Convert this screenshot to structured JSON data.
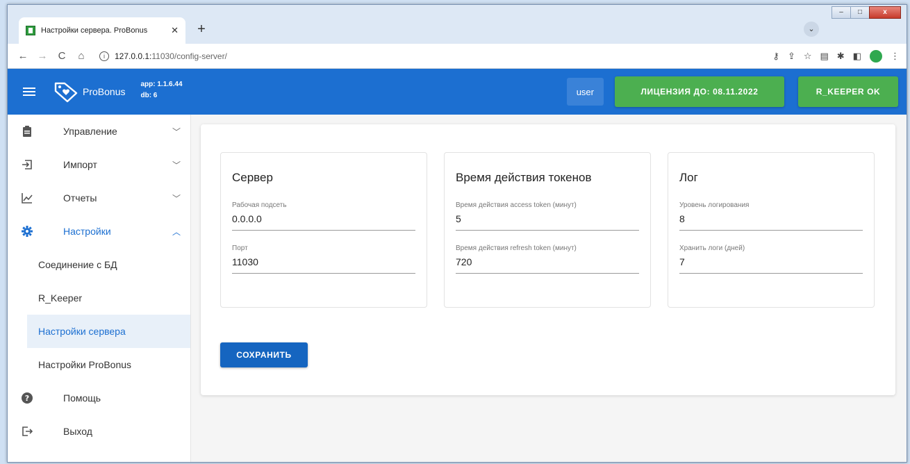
{
  "browser": {
    "tab_title": "Настройки сервера. ProBonus",
    "tab_close": "✕",
    "new_tab": "+",
    "url_host": "127.0.0.1:",
    "url_rest": "11030/config-server/"
  },
  "header": {
    "app_name": "ProBonus",
    "app_version": "app: 1.1.6.44",
    "db_version": "db: 6",
    "user_label": "user",
    "license_label": "ЛИЦЕНЗИЯ ДО: 08.11.2022",
    "rkeeper_label": "R_KEEPER OK",
    "accent_color": "#1c6fd1",
    "ok_color": "#4caf50"
  },
  "sidebar": {
    "items": [
      {
        "label": "Управление",
        "icon": "clipboard-icon",
        "expanded": false
      },
      {
        "label": "Импорт",
        "icon": "import-icon",
        "expanded": false
      },
      {
        "label": "Отчеты",
        "icon": "chart-icon",
        "expanded": false
      },
      {
        "label": "Настройки",
        "icon": "gear-icon",
        "expanded": true
      }
    ],
    "sub_items": [
      {
        "label": "Соединение с БД"
      },
      {
        "label": "R_Keeper"
      },
      {
        "label": "Настройки сервера",
        "active": true
      },
      {
        "label": "Настройки ProBonus"
      }
    ],
    "bottom_items": [
      {
        "label": "Помощь",
        "icon": "help-icon"
      },
      {
        "label": "Выход",
        "icon": "logout-icon"
      }
    ]
  },
  "main": {
    "cards": [
      {
        "title": "Сервер",
        "fields": [
          {
            "label": "Рабочая подсеть",
            "value": "0.0.0.0"
          },
          {
            "label": "Порт",
            "value": "11030"
          }
        ]
      },
      {
        "title": "Время действия токенов",
        "fields": [
          {
            "label": "Время действия access token (минут)",
            "value": "5"
          },
          {
            "label": "Время действия refresh token (минут)",
            "value": "720"
          }
        ]
      },
      {
        "title": "Лог",
        "fields": [
          {
            "label": "Уровень логирования",
            "value": "8"
          },
          {
            "label": "Хранить логи (дней)",
            "value": "7"
          }
        ]
      }
    ],
    "save_label": "СОХРАНИТЬ"
  }
}
